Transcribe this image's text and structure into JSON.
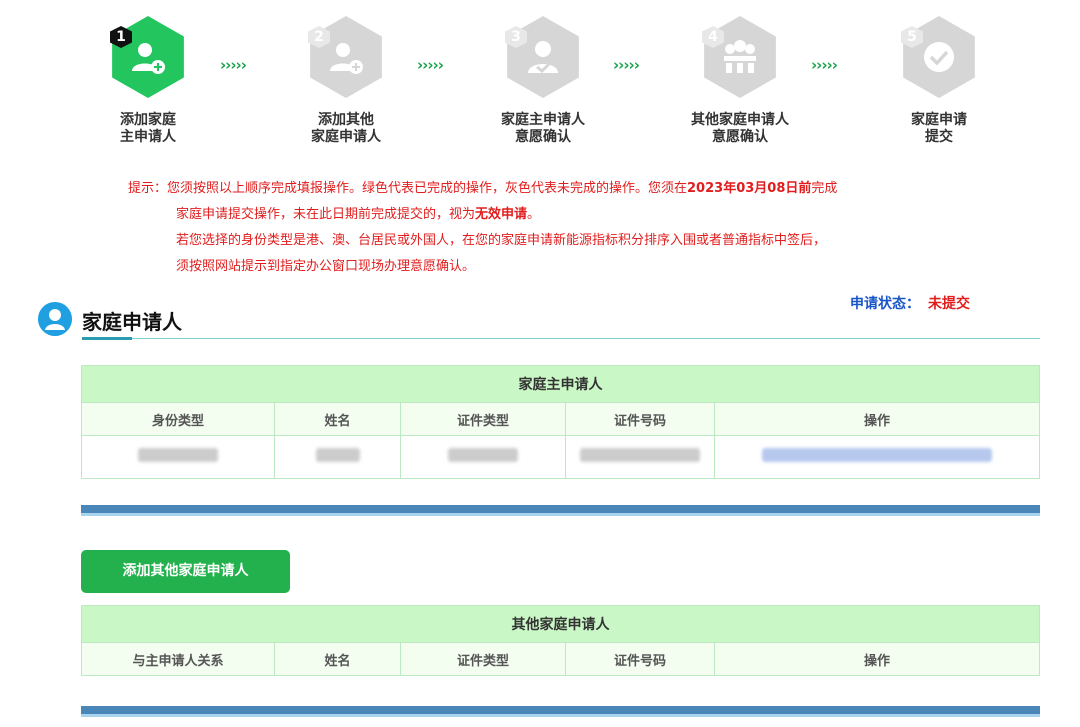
{
  "steps": [
    {
      "num": "1",
      "label_l1": "添加家庭",
      "label_l2": "主申请人",
      "state": "done",
      "icon": "add-user-icon"
    },
    {
      "num": "2",
      "label_l1": "添加其他",
      "label_l2": "家庭申请人",
      "state": "pending",
      "icon": "add-user-icon"
    },
    {
      "num": "3",
      "label_l1": "家庭主申请人",
      "label_l2": "意愿确认",
      "state": "pending",
      "icon": "user-check-icon"
    },
    {
      "num": "4",
      "label_l1": "其他家庭申请人",
      "label_l2": "意愿确认",
      "state": "pending",
      "icon": "group-icon"
    },
    {
      "num": "5",
      "label_l1": "家庭申请",
      "label_l2": "提交",
      "state": "pending",
      "icon": "check-circle-icon"
    }
  ],
  "arrows": "›››››",
  "notice": {
    "l1_a": "提示：您须按照以上顺序完成填报操作。绿色代表已完成的操作，灰色代表未完成的操作。您须在",
    "l1_deadline": "2023年03月08日前",
    "l1_b": "完成",
    "l2_a": "家庭申请提交操作，未在此日期前完成提交的，视为",
    "l2_invalid": "无效申请",
    "l2_b": "。",
    "l3": "若您选择的身份类型是港、澳、台居民或外国人，在您的家庭申请新能源指标积分排序入围或者普通指标中签后，",
    "l4": "须按照网站提示到指定办公窗口现场办理意愿确认。"
  },
  "section": {
    "title": "家庭申请人",
    "status_label": "申请状态：",
    "status_value": "未提交"
  },
  "main_table": {
    "caption": "家庭主申请人",
    "headers": [
      "身份类型",
      "姓名",
      "证件类型",
      "证件号码",
      "操作"
    ]
  },
  "add_button": "添加其他家庭申请人",
  "other_table": {
    "caption": "其他家庭申请人",
    "headers": [
      "与主申请人关系",
      "姓名",
      "证件类型",
      "证件号码",
      "操作"
    ]
  },
  "colors": {
    "done_green": "#22c55e",
    "pending_gray": "#d6d6d6",
    "alert_red": "#e11d1d",
    "status_blue": "#1a56c8"
  }
}
